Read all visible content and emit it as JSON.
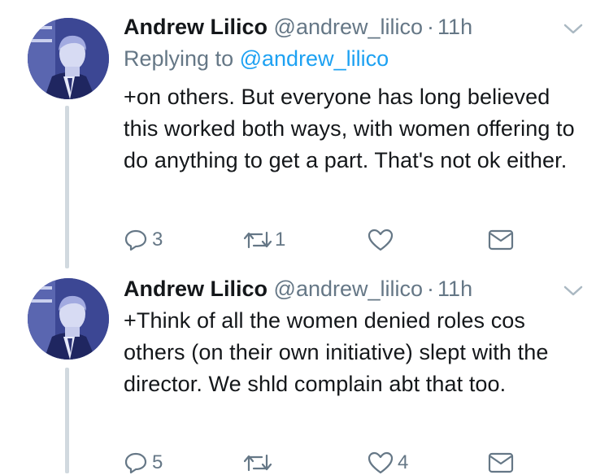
{
  "tweets": [
    {
      "name": "Andrew Lilico",
      "handle": "@andrew_lilico",
      "separator": "·",
      "time": "11h",
      "replying_prefix": "Replying to",
      "replying_to": "@andrew_lilico",
      "text": "+on others. But everyone has long believed this worked both ways, with women offering to do anything to get a part. That's not ok either.",
      "actions": {
        "reply_count": "3",
        "retweet_count": "1",
        "like_count": ""
      },
      "icons": [
        "chevron-down-icon",
        "reply-icon",
        "retweet-icon",
        "like-icon",
        "dm-icon"
      ]
    },
    {
      "name": "Andrew Lilico",
      "handle": "@andrew_lilico",
      "separator": "·",
      "time": "11h",
      "text": "+Think of all the women denied roles cos others (on their own initiative) slept with the director. We shld complain abt that too.",
      "actions": {
        "reply_count": "5",
        "retweet_count": "",
        "like_count": "4"
      },
      "icons": [
        "chevron-down-icon",
        "reply-icon",
        "retweet-icon",
        "like-icon",
        "dm-icon"
      ]
    }
  ],
  "colors": {
    "text": "#14171a",
    "secondary": "#657786",
    "link": "#1da1f2",
    "thread_line": "#d1d9df",
    "avatar_tint": "#3f4a9a"
  }
}
